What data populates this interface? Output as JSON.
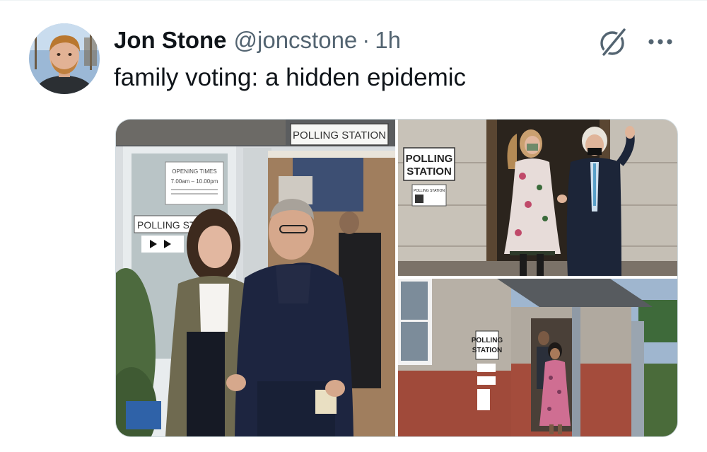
{
  "tweet": {
    "display_name": "Jon Stone",
    "handle": "@joncstone",
    "separator": "·",
    "timestamp": "1h",
    "text": "family voting: a hidden epidemic"
  },
  "icons": {
    "grok": "grok-icon",
    "more": "more-options-icon"
  },
  "media": {
    "photo_1": {
      "sign_polling_station_top": "POLLING STATION",
      "sign_opening_times": "OPENING TIMES",
      "sign_opening_hours": "7.00am – 10.00pm",
      "sign_polling_station_door": "POLLING STA"
    },
    "photo_2": {
      "sign_line1": "POLLING",
      "sign_line2": "STATION",
      "sign_small": "POLLING STATION"
    },
    "photo_3": {
      "sign_line1": "POLLING",
      "sign_line2": "STATION"
    }
  },
  "colors": {
    "text_primary": "#0f1419",
    "text_secondary": "#536471",
    "border": "#cfd9de"
  }
}
